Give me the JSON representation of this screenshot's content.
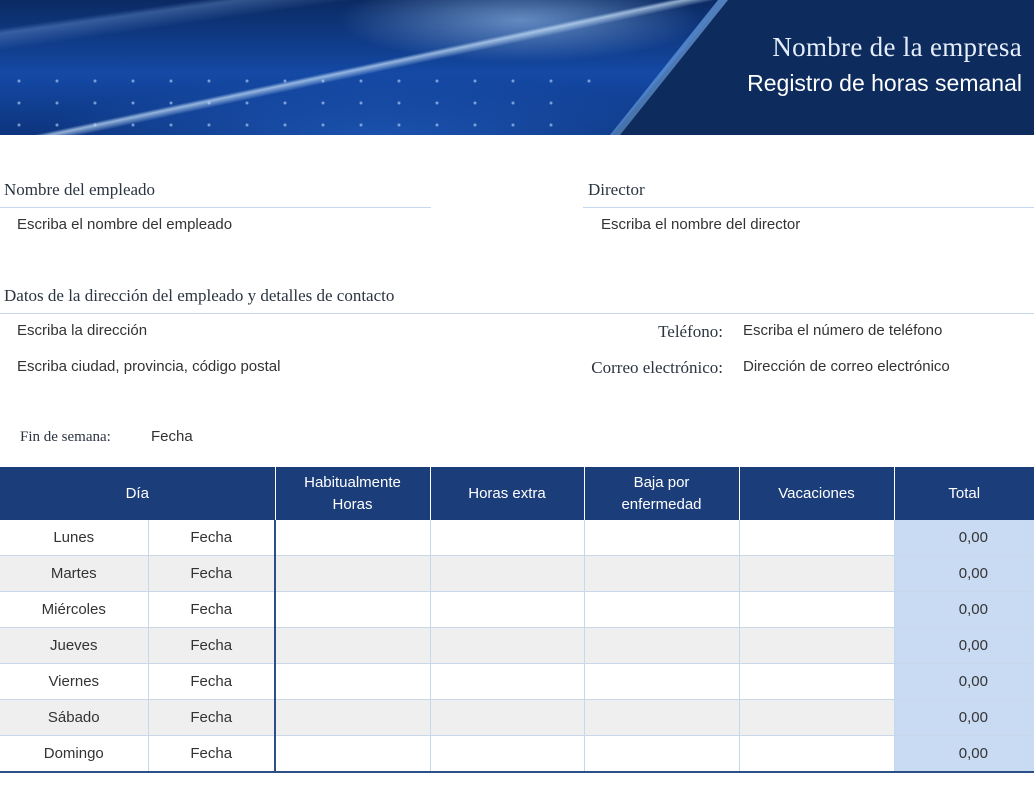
{
  "header": {
    "company": "Nombre de la empresa",
    "title": "Registro de horas semanal"
  },
  "employee": {
    "label": "Nombre del empleado",
    "value": "Escriba el nombre del empleado"
  },
  "director": {
    "label": "Director",
    "value": "Escriba el nombre del director"
  },
  "contact": {
    "label": "Datos de la dirección del empleado y detalles de contacto",
    "address": "Escriba la dirección",
    "city": "Escriba ciudad, provincia, código postal",
    "phone_label": "Teléfono:",
    "phone_value": "Escriba el número de teléfono",
    "email_label": "Correo electrónico:",
    "email_value": "Dirección de correo electrónico"
  },
  "week": {
    "label": "Fin de semana:",
    "value": "Fecha"
  },
  "table": {
    "headers": {
      "day": "Día",
      "regular_line1": "Habitualmente",
      "regular_line2": "Horas",
      "overtime": "Horas extra",
      "sick_line1": "Baja por",
      "sick_line2": "enfermedad",
      "vacation": "Vacaciones",
      "total": "Total"
    },
    "rows": [
      {
        "day": "Lunes",
        "date": "Fecha",
        "total": "0,00"
      },
      {
        "day": "Martes",
        "date": "Fecha",
        "total": "0,00"
      },
      {
        "day": "Miércoles",
        "date": "Fecha",
        "total": "0,00"
      },
      {
        "day": "Jueves",
        "date": "Fecha",
        "total": "0,00"
      },
      {
        "day": "Viernes",
        "date": "Fecha",
        "total": "0,00"
      },
      {
        "day": "Sábado",
        "date": "Fecha",
        "total": "0,00"
      },
      {
        "day": "Domingo",
        "date": "Fecha",
        "total": "0,00"
      }
    ]
  },
  "colors": {
    "header_bg": "#1b3d7a",
    "total_bg": "#c9daf3",
    "alt_row_bg": "#efefef"
  }
}
